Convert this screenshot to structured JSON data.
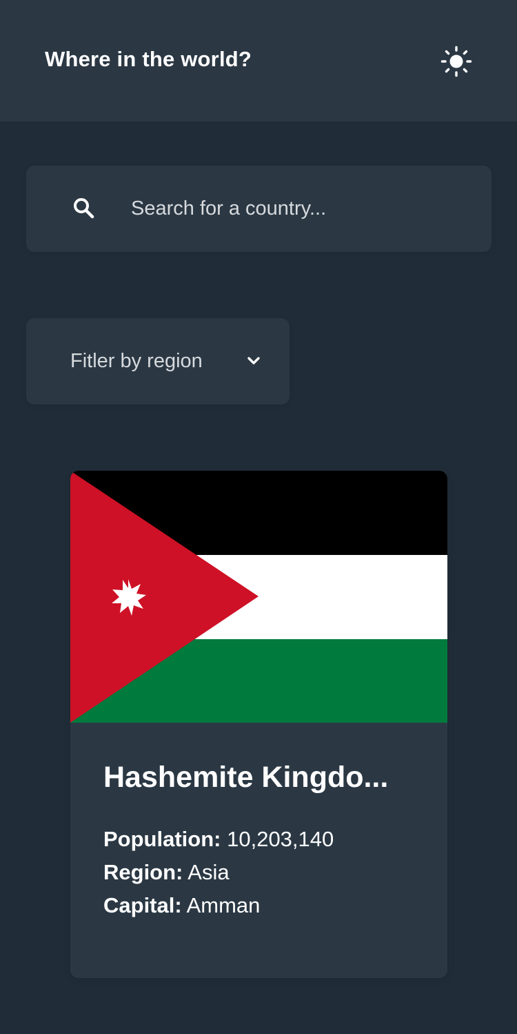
{
  "header": {
    "title": "Where in the world?",
    "theme_icon": "sun-icon"
  },
  "search": {
    "icon": "search-icon",
    "placeholder": "Search for a country...",
    "value": ""
  },
  "filter": {
    "label": "Fitler by region",
    "icon": "chevron-down-icon"
  },
  "countries": [
    {
      "name": "Hashemite Kingdo...",
      "flag": "jordan-flag",
      "population_label": "Population:",
      "population": "10,203,140",
      "region_label": "Region:",
      "region": "Asia",
      "capital_label": "Capital:",
      "capital": "Amman"
    }
  ],
  "colors": {
    "background": "#202c37",
    "surface": "#2b3844",
    "text": "#ffffff",
    "placeholder": "#d7dadd",
    "flag_black": "#000000",
    "flag_white": "#ffffff",
    "flag_green": "#007a3d",
    "flag_red": "#ce1126"
  }
}
